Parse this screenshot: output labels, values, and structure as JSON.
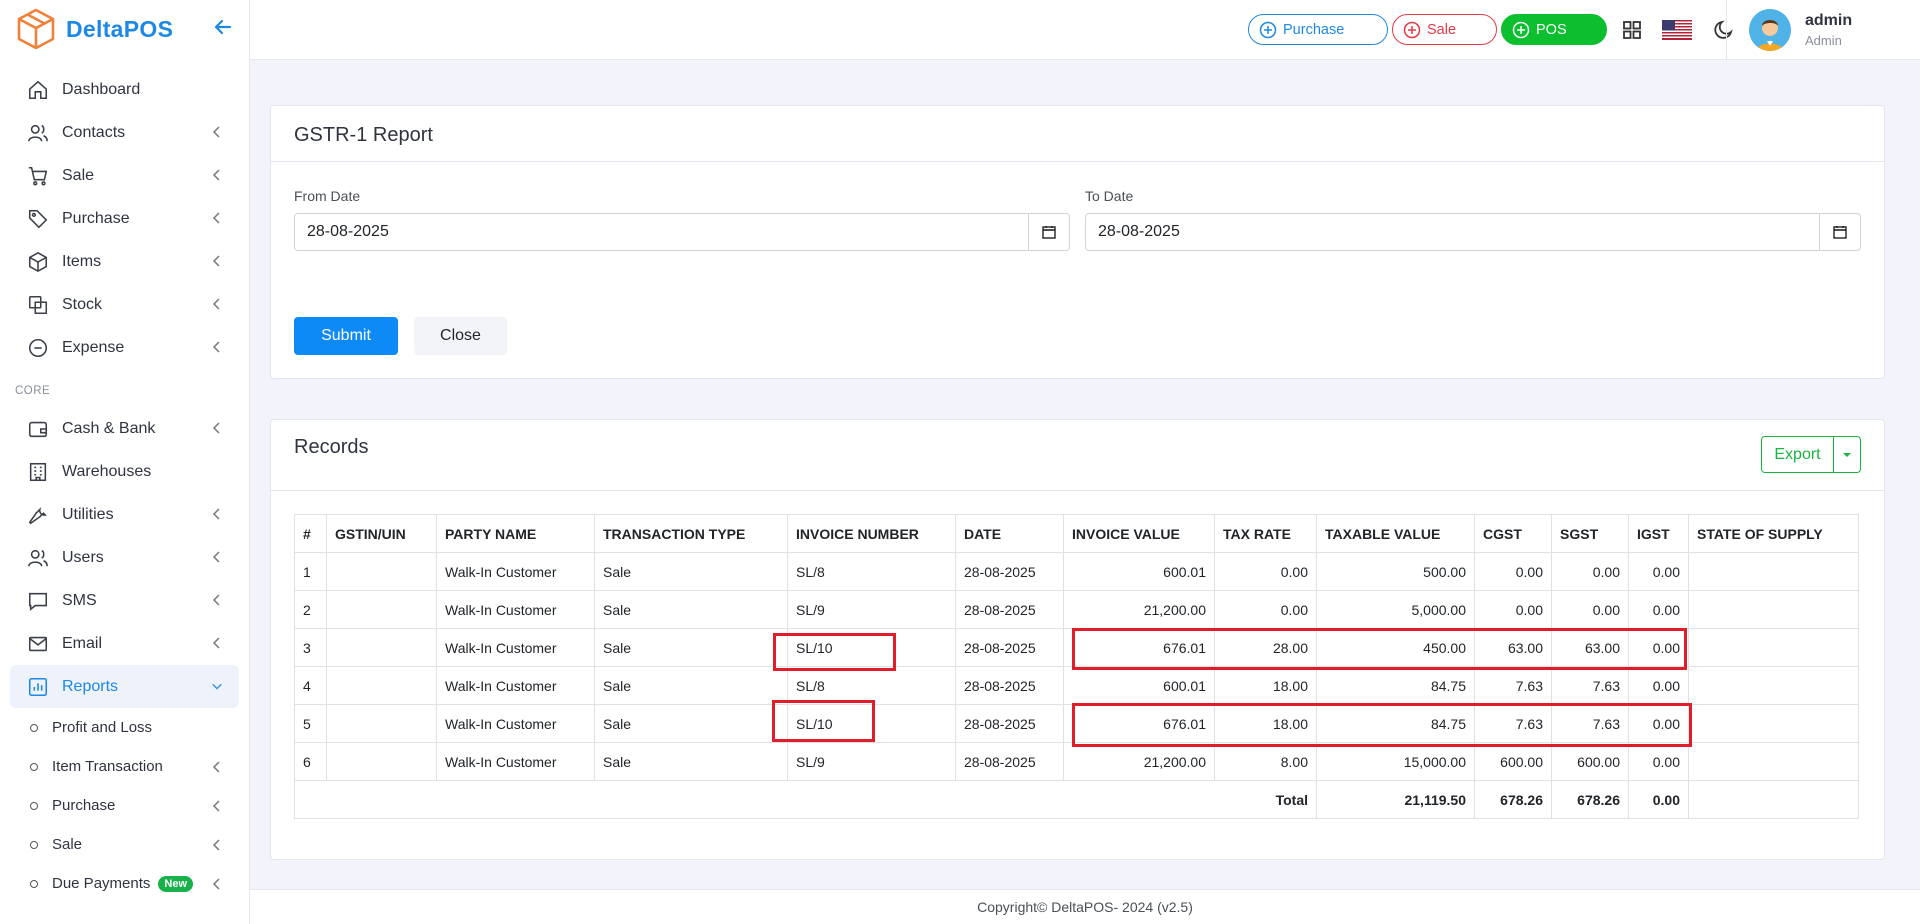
{
  "app": {
    "name": "DeltaPOS"
  },
  "sidebar": {
    "items": [
      {
        "label": "Dashboard",
        "icon": "home-icon"
      },
      {
        "label": "Contacts",
        "icon": "users-icon"
      },
      {
        "label": "Sale",
        "icon": "cart-icon"
      },
      {
        "label": "Purchase",
        "icon": "tag-icon"
      },
      {
        "label": "Items",
        "icon": "box-icon"
      },
      {
        "label": "Stock",
        "icon": "stock-icon"
      },
      {
        "label": "Expense",
        "icon": "minus-circle-icon"
      }
    ],
    "section_core": "CORE",
    "core_items": [
      {
        "label": "Cash & Bank",
        "icon": "wallet-icon"
      },
      {
        "label": "Warehouses",
        "icon": "building-icon"
      },
      {
        "label": "Utilities",
        "icon": "wrench-icon"
      },
      {
        "label": "Users",
        "icon": "users-icon"
      },
      {
        "label": "SMS",
        "icon": "sms-icon"
      },
      {
        "label": "Email",
        "icon": "mail-icon"
      },
      {
        "label": "Reports",
        "icon": "chart-icon"
      }
    ],
    "report_subitems": [
      "Profit and Loss",
      "Item Transaction",
      "Purchase",
      "Sale",
      "Due Payments"
    ],
    "badge_new": "New"
  },
  "topbar": {
    "purchase": "Purchase",
    "sale": "Sale",
    "pos": "POS",
    "user_name": "admin",
    "user_role": "Admin"
  },
  "filter": {
    "title": "GSTR-1 Report",
    "from_label": "From Date",
    "from_value": "28-08-2025",
    "to_label": "To Date",
    "to_value": "28-08-2025",
    "submit": "Submit",
    "close": "Close"
  },
  "records": {
    "title": "Records",
    "export": "Export",
    "headers": [
      "#",
      "GSTIN/UIN",
      "PARTY NAME",
      "TRANSACTION TYPE",
      "INVOICE NUMBER",
      "DATE",
      "INVOICE VALUE",
      "TAX RATE",
      "TAXABLE VALUE",
      "CGST",
      "SGST",
      "IGST",
      "STATE OF SUPPLY"
    ],
    "rows": [
      [
        "1",
        "",
        "Walk-In Customer",
        "Sale",
        "SL/8",
        "28-08-2025",
        "600.01",
        "0.00",
        "500.00",
        "0.00",
        "0.00",
        "0.00",
        ""
      ],
      [
        "2",
        "",
        "Walk-In Customer",
        "Sale",
        "SL/9",
        "28-08-2025",
        "21,200.00",
        "0.00",
        "5,000.00",
        "0.00",
        "0.00",
        "0.00",
        ""
      ],
      [
        "3",
        "",
        "Walk-In Customer",
        "Sale",
        "SL/10",
        "28-08-2025",
        "676.01",
        "28.00",
        "450.00",
        "63.00",
        "63.00",
        "0.00",
        ""
      ],
      [
        "4",
        "",
        "Walk-In Customer",
        "Sale",
        "SL/8",
        "28-08-2025",
        "600.01",
        "18.00",
        "84.75",
        "7.63",
        "7.63",
        "0.00",
        ""
      ],
      [
        "5",
        "",
        "Walk-In Customer",
        "Sale",
        "SL/10",
        "28-08-2025",
        "676.01",
        "18.00",
        "84.75",
        "7.63",
        "7.63",
        "0.00",
        ""
      ],
      [
        "6",
        "",
        "Walk-In Customer",
        "Sale",
        "SL/9",
        "28-08-2025",
        "21,200.00",
        "8.00",
        "15,000.00",
        "600.00",
        "600.00",
        "0.00",
        ""
      ]
    ],
    "total_label": "Total",
    "total_taxable": "21,119.50",
    "total_cgst": "678.26",
    "total_sgst": "678.26",
    "total_igst": "0.00"
  },
  "footer": {
    "text": "Copyright© DeltaPOS- 2024 (v2.5)"
  },
  "colors": {
    "accent": "#1e88e5",
    "sale": "#e53945",
    "pos": "#0bbf2e",
    "highlight": "#e01e2a"
  }
}
